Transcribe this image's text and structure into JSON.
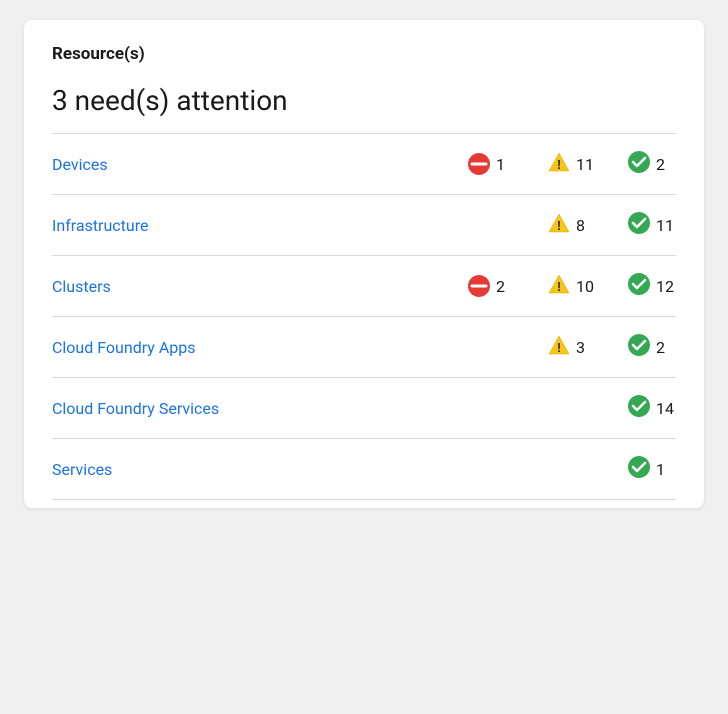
{
  "card": {
    "title": "Resource(s)",
    "attention_heading": "3 need(s) attention"
  },
  "rows": [
    {
      "name": "Devices",
      "blocked": {
        "show": true,
        "count": "1"
      },
      "warning": {
        "show": true,
        "count": "11"
      },
      "ok": {
        "show": true,
        "count": "2"
      }
    },
    {
      "name": "Infrastructure",
      "blocked": {
        "show": false,
        "count": ""
      },
      "warning": {
        "show": true,
        "count": "8"
      },
      "ok": {
        "show": true,
        "count": "11"
      }
    },
    {
      "name": "Clusters",
      "blocked": {
        "show": true,
        "count": "2"
      },
      "warning": {
        "show": true,
        "count": "10"
      },
      "ok": {
        "show": true,
        "count": "12"
      }
    },
    {
      "name": "Cloud Foundry Apps",
      "blocked": {
        "show": false,
        "count": ""
      },
      "warning": {
        "show": true,
        "count": "3"
      },
      "ok": {
        "show": true,
        "count": "2"
      }
    },
    {
      "name": "Cloud Foundry Services",
      "blocked": {
        "show": false,
        "count": ""
      },
      "warning": {
        "show": false,
        "count": ""
      },
      "ok": {
        "show": true,
        "count": "14"
      }
    },
    {
      "name": "Services",
      "blocked": {
        "show": false,
        "count": ""
      },
      "warning": {
        "show": false,
        "count": ""
      },
      "ok": {
        "show": true,
        "count": "1"
      }
    }
  ],
  "icons": {
    "blocked_color": "#e53935",
    "warning_color": "#f5a623",
    "ok_color": "#34a853"
  }
}
